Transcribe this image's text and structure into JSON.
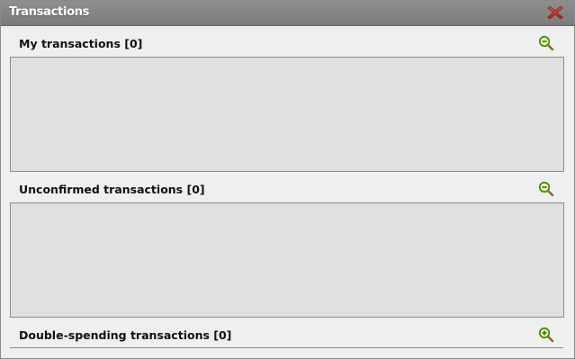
{
  "window": {
    "title": "Transactions",
    "close_icon": "close-x-icon",
    "accent_close": "#c0392b"
  },
  "sections": [
    {
      "label": "My transactions [0]",
      "icon": "zoom-out-icon",
      "expanded": true
    },
    {
      "label": "Unconfirmed transactions [0]",
      "icon": "zoom-out-icon",
      "expanded": true
    },
    {
      "label": "Double-spending transactions [0]",
      "icon": "zoom-in-icon",
      "expanded": false
    }
  ]
}
